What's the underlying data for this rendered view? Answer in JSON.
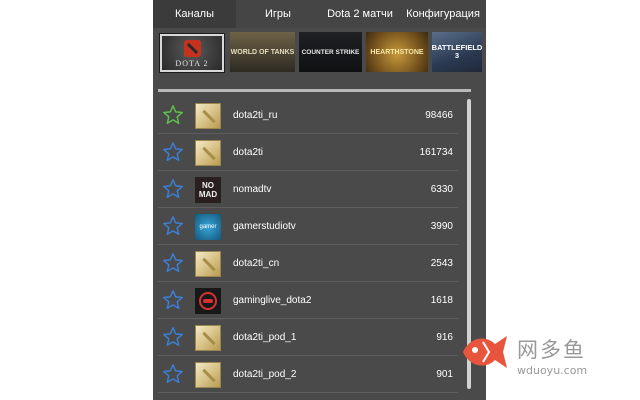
{
  "tabs": [
    {
      "label": "Каналы",
      "active": true
    },
    {
      "label": "Игры",
      "active": false
    },
    {
      "label": "Dota 2 матчи",
      "active": false
    },
    {
      "label": "Конфигурация",
      "active": false
    }
  ],
  "games": [
    {
      "id": "dota2",
      "caption": "DOTA 2",
      "selected": true
    },
    {
      "id": "world-of-tanks",
      "caption": "WORLD OF TANKS"
    },
    {
      "id": "counter-strike",
      "caption": "COUNTER STRIKE"
    },
    {
      "id": "hearthstone",
      "caption": "HEARTHSTONE"
    },
    {
      "id": "battlefield-3",
      "caption": "BATTLEFIELD 3"
    }
  ],
  "channels": [
    {
      "name": "dota2ti_ru",
      "viewers": "98466",
      "star_color": "#5cc24a",
      "avatar": "dota"
    },
    {
      "name": "dota2ti",
      "viewers": "161734",
      "star_color": "#3c7fd6",
      "avatar": "dota"
    },
    {
      "name": "nomadtv",
      "viewers": "6330",
      "star_color": "#3c7fd6",
      "avatar": "nomad",
      "avatar_text": "NO MAD"
    },
    {
      "name": "gamerstudiotv",
      "viewers": "3990",
      "star_color": "#3c7fd6",
      "avatar": "gstudio",
      "avatar_text": "gamer"
    },
    {
      "name": "dota2ti_cn",
      "viewers": "2543",
      "star_color": "#3c7fd6",
      "avatar": "dota"
    },
    {
      "name": "gaminglive_dota2",
      "viewers": "1618",
      "star_color": "#3c7fd6",
      "avatar": "glive"
    },
    {
      "name": "dota2ti_pod_1",
      "viewers": "916",
      "star_color": "#3c7fd6",
      "avatar": "dota"
    },
    {
      "name": "dota2ti_pod_2",
      "viewers": "901",
      "star_color": "#3c7fd6",
      "avatar": "dota"
    }
  ],
  "watermark": {
    "title": "网多鱼",
    "url": "wduoyu.com",
    "color": "#e8553d"
  }
}
